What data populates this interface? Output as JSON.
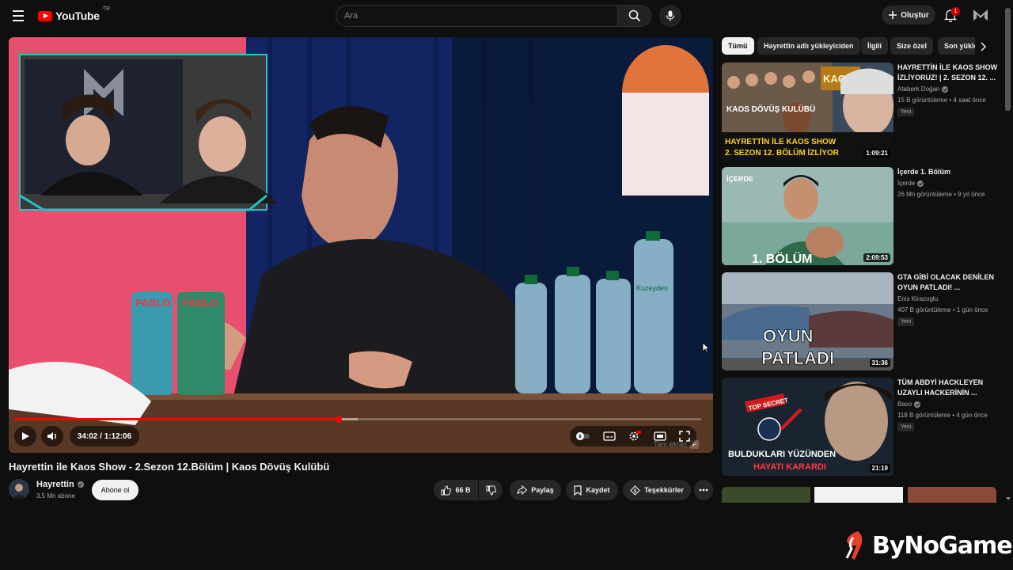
{
  "header": {
    "logo_text": "YouTube",
    "logo_country": "TR",
    "search_placeholder": "Ara",
    "create_label": "Oluştur",
    "notification_count": "1"
  },
  "player": {
    "time_display": "34:02 / 1:12:06",
    "progress_fraction": 0.472,
    "buffer_fraction": 0.5,
    "fullscreen_tooltip": "Tam ekran",
    "fullscreen_key": "F",
    "bottle_brand": "Kuzeyden",
    "can_brand": "PABLO"
  },
  "video": {
    "title": "Hayrettin ile Kaos Show - 2.Sezon 12.Bölüm | Kaos Dövüş Kulübü",
    "channel": "Hayrettin",
    "subscribers": "3,5 Mn abone",
    "subscribe_label": "Abone ol",
    "likes": "66 B",
    "share_label": "Paylaş",
    "save_label": "Kaydet",
    "thanks_label": "Teşekkürler"
  },
  "chips": [
    "Tümü",
    "Hayrettin adlı yükleyiciden",
    "İlgili",
    "Size özel",
    "Son yüklenenler"
  ],
  "recommendations": [
    {
      "title": "HAYRETTİN İLE KAOS SHOW İZLİYORUZ! | 2. SEZON 12. ...",
      "channel": "Ataberk Doğan",
      "meta": "15 B görüntüleme • 4 saat önce",
      "badge": "Yeni",
      "duration": "1:09:21",
      "thumb_text_1": "KAOS DÖVÜŞ KULÜBÜ",
      "thumb_text_2": "HAYRETTİN İLE KAOS SHOW",
      "thumb_text_3": "2. SEZON 12. BÖLÜM İZLİYOR"
    },
    {
      "title": "İçerde 1. Bölüm",
      "channel": "İçerde",
      "meta": "26 Mn görüntüleme • 9 yıl önce",
      "badge": "",
      "duration": "2:09:53",
      "thumb_text_1": "İÇERDE",
      "thumb_text_2": "1. BÖLÜM"
    },
    {
      "title": "GTA GİBİ OLACAK DENİLEN OYUN PATLADI! ...",
      "channel": "Enis Kirazoglu",
      "meta": "407 B görüntüleme • 1 gün önce",
      "badge": "Yeni",
      "duration": "31:36",
      "thumb_text_1": "OYUN",
      "thumb_text_2": "PATLADI"
    },
    {
      "title": "TÜM ABDYİ HACKLEYEN UZAYLI HACKERİNİN ...",
      "channel": "Baso",
      "meta": "118 B görüntüleme • 4 gün önce",
      "badge": "Yeni",
      "duration": "21:19",
      "thumb_text_1": "TOP SECRET",
      "thumb_text_2": "BULDUKLARI YÜZÜNDEN",
      "thumb_text_3": "HAYATI KARARDI"
    }
  ],
  "watermark": "ByNoGame",
  "colors": {
    "accent": "#ff0000",
    "bg": "#0f0f0f",
    "chip": "#272727"
  }
}
